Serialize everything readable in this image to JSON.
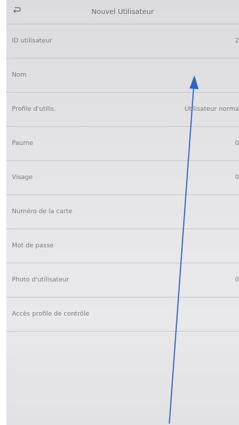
{
  "header": {
    "title": "Nouvel Utilisateur",
    "back_icon": "back-arrow-icon"
  },
  "form": {
    "rows": [
      {
        "label": "ID utilisateur",
        "value": "2"
      },
      {
        "label": "Nom",
        "value": ""
      },
      {
        "label": "Profile d'utilis.",
        "value": "Utilisateur norma"
      },
      {
        "label": "Paume",
        "value": "0"
      },
      {
        "label": "Visage",
        "value": "0"
      },
      {
        "label": "Numéro de la carte",
        "value": ""
      },
      {
        "label": "Mot de passe",
        "value": ""
      },
      {
        "label": "Photo d'utilisateur",
        "value": "0"
      },
      {
        "label": "Accès profile de contrôle",
        "value": ""
      }
    ]
  },
  "annotation": {
    "color": "#2f63c2"
  }
}
